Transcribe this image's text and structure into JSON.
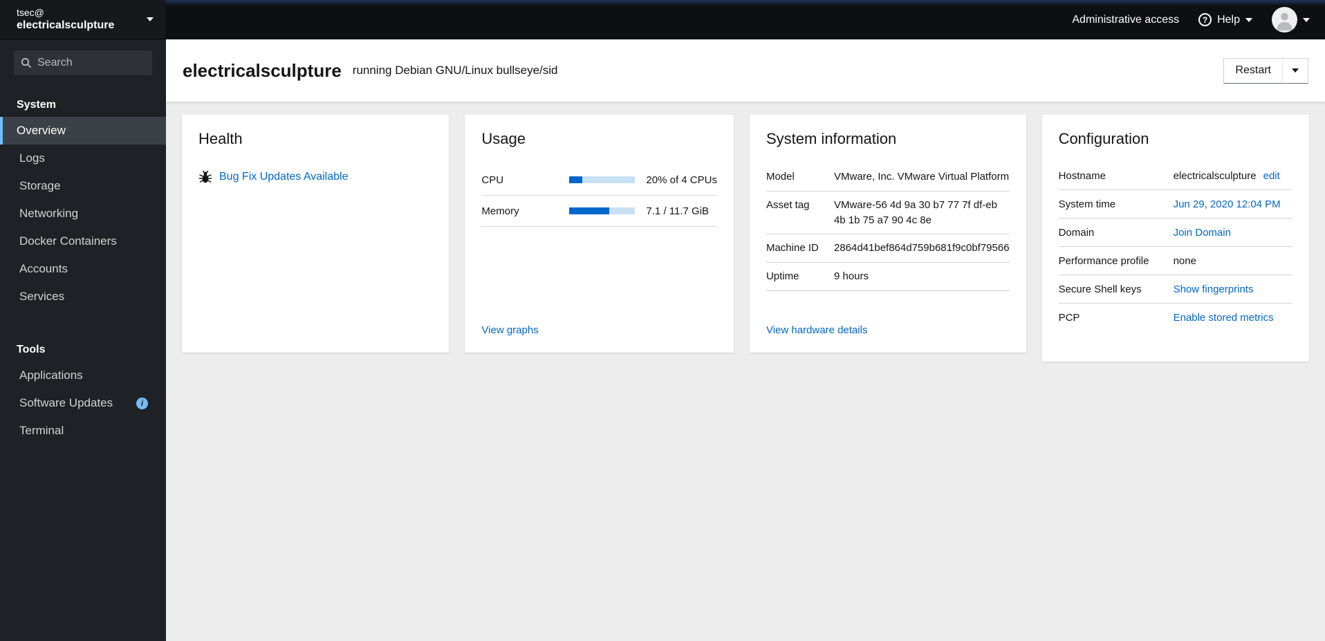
{
  "colors": {
    "accent_blue": "#0066cc",
    "nav_selected_border": "#73bcf7",
    "progress_fill": "#0066cc",
    "progress_track": "#c7e0f4",
    "sidebar_bg": "#1e2125",
    "masthead_bg": "#0d0f11",
    "page_bg": "#ededed"
  },
  "icons": {
    "help_glyph": "?",
    "info_glyph": "i"
  },
  "sidebar": {
    "host_user": "tsec@",
    "host_name": "electricalsculpture",
    "search_placeholder": "Search",
    "sections": [
      {
        "label": "System",
        "items": [
          {
            "label": "Overview",
            "selected": true
          },
          {
            "label": "Logs"
          },
          {
            "label": "Storage"
          },
          {
            "label": "Networking"
          },
          {
            "label": "Docker Containers"
          },
          {
            "label": "Accounts"
          },
          {
            "label": "Services"
          }
        ]
      },
      {
        "label": "Tools",
        "items": [
          {
            "label": "Applications"
          },
          {
            "label": "Software Updates",
            "badge": "info"
          },
          {
            "label": "Terminal"
          }
        ]
      }
    ]
  },
  "masthead": {
    "admin_access_label": "Administrative access",
    "help_label": "Help"
  },
  "page_header": {
    "hostname": "electricalsculpture",
    "os_text": "running Debian GNU/Linux bullseye/sid",
    "restart_label": "Restart"
  },
  "cards": {
    "health": {
      "title": "Health",
      "updates_link": "Bug Fix Updates Available"
    },
    "usage": {
      "title": "Usage",
      "rows": [
        {
          "label": "CPU",
          "percent": 20,
          "value": "20% of 4 CPUs"
        },
        {
          "label": "Memory",
          "percent": 61,
          "value": "7.1 / 11.7 GiB"
        }
      ],
      "footer_link": "View graphs"
    },
    "system_info": {
      "title": "System information",
      "rows": [
        {
          "label": "Model",
          "value": "VMware, Inc. VMware Virtual Platform"
        },
        {
          "label": "Asset tag",
          "value": "VMware-56 4d 9a 30 b7 77 7f df-eb 4b 1b 75 a7 90 4c 8e"
        },
        {
          "label": "Machine ID",
          "value": "2864d41bef864d759b681f9c0bf79566"
        },
        {
          "label": "Uptime",
          "value": "9 hours"
        }
      ],
      "footer_link": "View hardware details"
    },
    "configuration": {
      "title": "Configuration",
      "rows": [
        {
          "label": "Hostname",
          "value": "electricalsculpture",
          "link": "edit"
        },
        {
          "label": "System time",
          "link": "Jun 29, 2020 12:04 PM"
        },
        {
          "label": "Domain",
          "link": "Join Domain"
        },
        {
          "label": "Performance profile",
          "value": "none"
        },
        {
          "label": "Secure Shell keys",
          "link": "Show fingerprints"
        },
        {
          "label": "PCP",
          "link": "Enable stored metrics"
        }
      ]
    }
  }
}
